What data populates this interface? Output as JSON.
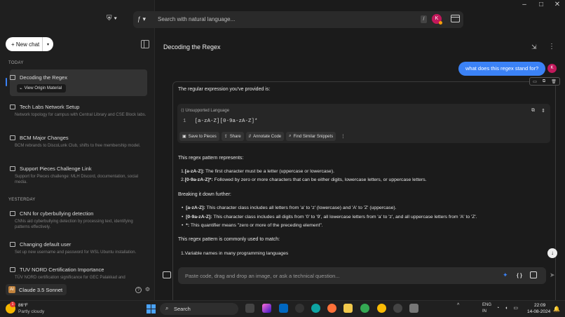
{
  "window": {
    "minimize": "–",
    "maximize": "□",
    "close": "✕"
  },
  "top": {
    "logo_icon": "⛨ ▾",
    "ai_icon": "ƒ ▾",
    "search_placeholder": "Search with natural language...",
    "shortcut": "/",
    "avatar": "K"
  },
  "sidebar": {
    "new_chat": "+ New chat",
    "today_header": "TODAY",
    "yesterday_header": "YESTERDAY",
    "today": [
      {
        "title": "Decoding the Regex",
        "sub": ""
      },
      {
        "title": "Tech Labs Network Setup",
        "sub": "Network topology for campus with Central Library and CSE Block labs."
      },
      {
        "title": "BCM Major Changes",
        "sub": "BCM rebrands to DiscoLunk Club, shifts to free membership model."
      },
      {
        "title": "Support Pieces Challenge Link",
        "sub": "Support for Pieces challenge: MLH Discord, documentation, social media."
      }
    ],
    "yesterday": [
      {
        "title": "CNN for cyberbullying detection",
        "sub": "CNNs aid cyberbullying detection by processing text, identifying patterns effectively."
      },
      {
        "title": "Changing default user",
        "sub": "Set up new username and password for WSL Ubuntu installation."
      },
      {
        "title": "TUV NORD Certification Importance",
        "sub": "TÜV NORD certification significance for GEC Palakkad and"
      }
    ],
    "view_origin": "View Origin Material",
    "model": "Claude 3.5 Sonnet",
    "model_logo": "AI",
    "help_icon": "?",
    "settings_icon": "⚙"
  },
  "conversation": {
    "title": "Decoding the Regex",
    "user_message": "what does this regex stand for?",
    "user_avatar": "K",
    "intro": "The regular expression you've provided is:",
    "code": {
      "language": "Unsupported Language",
      "line_no": "1",
      "line": "[a-zA-Z][0-9a-zA-Z]*",
      "actions": [
        "Save to Pieces",
        "Share",
        "Annotate Code",
        "Find Similar Snippets",
        "⋮"
      ]
    },
    "represents": "This regex pattern represents:",
    "points": [
      {
        "num": "1.",
        "key": "[a-zA-Z]:",
        "text": " The first character must be a letter (uppercase or lowercase)."
      },
      {
        "num": "2.",
        "key": "[0-9a-zA-Z]*:",
        "text": " Followed by zero or more characters that can be either digits, lowercase letters, or uppercase letters."
      }
    ],
    "breakdown": "Breaking it down further:",
    "bullets": [
      {
        "key": "[a-zA-Z]:",
        "text": " This character class includes all letters from 'a' to 'z' (lowercase) and 'A' to 'Z' (uppercase)."
      },
      {
        "key": "[0-9a-zA-Z]:",
        "text": " This character class includes all digits from '0' to '9', all lowercase letters from 'a' to 'z', and all uppercase letters from 'A' to 'Z'."
      },
      {
        "key": "*:",
        "text": " This quantifier means \"zero or more of the preceding element\"."
      }
    ],
    "used_to": "This regex pattern is commonly used to match:",
    "uses": [
      {
        "num": "1.",
        "text": "Variable names in many programming languages"
      }
    ]
  },
  "composer": {
    "placeholder": "Paste code, drag and drop an image, or ask a technical question...",
    "code_icon": "{ }",
    "send_icon": "➤"
  },
  "taskbar": {
    "weather_temp": "86°F",
    "weather_desc": "Partly cloudy",
    "weather_badge": "1",
    "search": "Search",
    "lang_top": "ENG",
    "lang_bottom": "IN",
    "time": "22:09",
    "date": "14-08-2024",
    "tray_chevron": "^"
  }
}
